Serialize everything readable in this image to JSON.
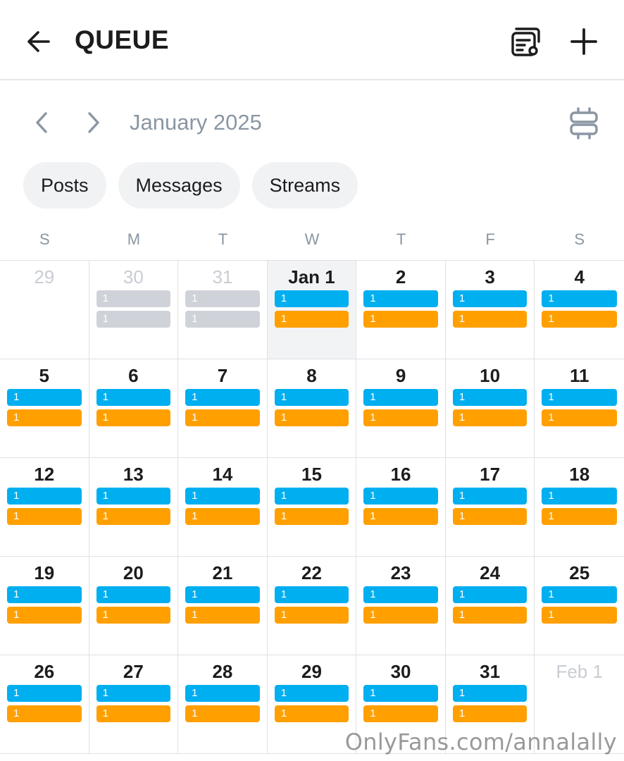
{
  "header": {
    "title": "QUEUE",
    "back_icon": "arrow-left-icon",
    "list_icon": "list-settings-icon",
    "add_icon": "plus-icon"
  },
  "calendar": {
    "month_label": "January 2025",
    "weekdays": [
      "S",
      "M",
      "T",
      "W",
      "T",
      "F",
      "S"
    ],
    "days": [
      {
        "label": "29",
        "muted": true,
        "bars": []
      },
      {
        "label": "30",
        "muted": true,
        "bars": [
          {
            "count": "1",
            "type": "gray"
          },
          {
            "count": "1",
            "type": "gray"
          }
        ]
      },
      {
        "label": "31",
        "muted": true,
        "bars": [
          {
            "count": "1",
            "type": "gray"
          },
          {
            "count": "1",
            "type": "gray"
          }
        ]
      },
      {
        "label": "Jan 1",
        "today": true,
        "bars": [
          {
            "count": "1",
            "type": "blue"
          },
          {
            "count": "1",
            "type": "orange"
          }
        ]
      },
      {
        "label": "2",
        "bars": [
          {
            "count": "1",
            "type": "blue"
          },
          {
            "count": "1",
            "type": "orange"
          }
        ]
      },
      {
        "label": "3",
        "bars": [
          {
            "count": "1",
            "type": "blue"
          },
          {
            "count": "1",
            "type": "orange"
          }
        ]
      },
      {
        "label": "4",
        "bars": [
          {
            "count": "1",
            "type": "blue"
          },
          {
            "count": "1",
            "type": "orange"
          }
        ]
      },
      {
        "label": "5",
        "bars": [
          {
            "count": "1",
            "type": "blue"
          },
          {
            "count": "1",
            "type": "orange"
          }
        ]
      },
      {
        "label": "6",
        "bars": [
          {
            "count": "1",
            "type": "blue"
          },
          {
            "count": "1",
            "type": "orange"
          }
        ]
      },
      {
        "label": "7",
        "bars": [
          {
            "count": "1",
            "type": "blue"
          },
          {
            "count": "1",
            "type": "orange"
          }
        ]
      },
      {
        "label": "8",
        "bars": [
          {
            "count": "1",
            "type": "blue"
          },
          {
            "count": "1",
            "type": "orange"
          }
        ]
      },
      {
        "label": "9",
        "bars": [
          {
            "count": "1",
            "type": "blue"
          },
          {
            "count": "1",
            "type": "orange"
          }
        ]
      },
      {
        "label": "10",
        "bars": [
          {
            "count": "1",
            "type": "blue"
          },
          {
            "count": "1",
            "type": "orange"
          }
        ]
      },
      {
        "label": "11",
        "bars": [
          {
            "count": "1",
            "type": "blue"
          },
          {
            "count": "1",
            "type": "orange"
          }
        ]
      },
      {
        "label": "12",
        "bars": [
          {
            "count": "1",
            "type": "blue"
          },
          {
            "count": "1",
            "type": "orange"
          }
        ]
      },
      {
        "label": "13",
        "bars": [
          {
            "count": "1",
            "type": "blue"
          },
          {
            "count": "1",
            "type": "orange"
          }
        ]
      },
      {
        "label": "14",
        "bars": [
          {
            "count": "1",
            "type": "blue"
          },
          {
            "count": "1",
            "type": "orange"
          }
        ]
      },
      {
        "label": "15",
        "bars": [
          {
            "count": "1",
            "type": "blue"
          },
          {
            "count": "1",
            "type": "orange"
          }
        ]
      },
      {
        "label": "16",
        "bars": [
          {
            "count": "1",
            "type": "blue"
          },
          {
            "count": "1",
            "type": "orange"
          }
        ]
      },
      {
        "label": "17",
        "bars": [
          {
            "count": "1",
            "type": "blue"
          },
          {
            "count": "1",
            "type": "orange"
          }
        ]
      },
      {
        "label": "18",
        "bars": [
          {
            "count": "1",
            "type": "blue"
          },
          {
            "count": "1",
            "type": "orange"
          }
        ]
      },
      {
        "label": "19",
        "bars": [
          {
            "count": "1",
            "type": "blue"
          },
          {
            "count": "1",
            "type": "orange"
          }
        ]
      },
      {
        "label": "20",
        "bars": [
          {
            "count": "1",
            "type": "blue"
          },
          {
            "count": "1",
            "type": "orange"
          }
        ]
      },
      {
        "label": "21",
        "bars": [
          {
            "count": "1",
            "type": "blue"
          },
          {
            "count": "1",
            "type": "orange"
          }
        ]
      },
      {
        "label": "22",
        "bars": [
          {
            "count": "1",
            "type": "blue"
          },
          {
            "count": "1",
            "type": "orange"
          }
        ]
      },
      {
        "label": "23",
        "bars": [
          {
            "count": "1",
            "type": "blue"
          },
          {
            "count": "1",
            "type": "orange"
          }
        ]
      },
      {
        "label": "24",
        "bars": [
          {
            "count": "1",
            "type": "blue"
          },
          {
            "count": "1",
            "type": "orange"
          }
        ]
      },
      {
        "label": "25",
        "bars": [
          {
            "count": "1",
            "type": "blue"
          },
          {
            "count": "1",
            "type": "orange"
          }
        ]
      },
      {
        "label": "26",
        "bars": [
          {
            "count": "1",
            "type": "blue"
          },
          {
            "count": "1",
            "type": "orange"
          }
        ]
      },
      {
        "label": "27",
        "bars": [
          {
            "count": "1",
            "type": "blue"
          },
          {
            "count": "1",
            "type": "orange"
          }
        ]
      },
      {
        "label": "28",
        "bars": [
          {
            "count": "1",
            "type": "blue"
          },
          {
            "count": "1",
            "type": "orange"
          }
        ]
      },
      {
        "label": "29",
        "bars": [
          {
            "count": "1",
            "type": "blue"
          },
          {
            "count": "1",
            "type": "orange"
          }
        ]
      },
      {
        "label": "30",
        "bars": [
          {
            "count": "1",
            "type": "blue"
          },
          {
            "count": "1",
            "type": "orange"
          }
        ]
      },
      {
        "label": "31",
        "bars": [
          {
            "count": "1",
            "type": "blue"
          },
          {
            "count": "1",
            "type": "orange"
          }
        ]
      },
      {
        "label": "Feb 1",
        "muted": true,
        "bars": []
      }
    ]
  },
  "filters": {
    "posts": "Posts",
    "messages": "Messages",
    "streams": "Streams"
  },
  "colors": {
    "posts_bar": "#00aff0",
    "messages_bar": "#ffa000",
    "past_bar": "#cfd3d9",
    "muted_text": "#8a96a3"
  },
  "watermark": "OnlyFans.com/annalally"
}
